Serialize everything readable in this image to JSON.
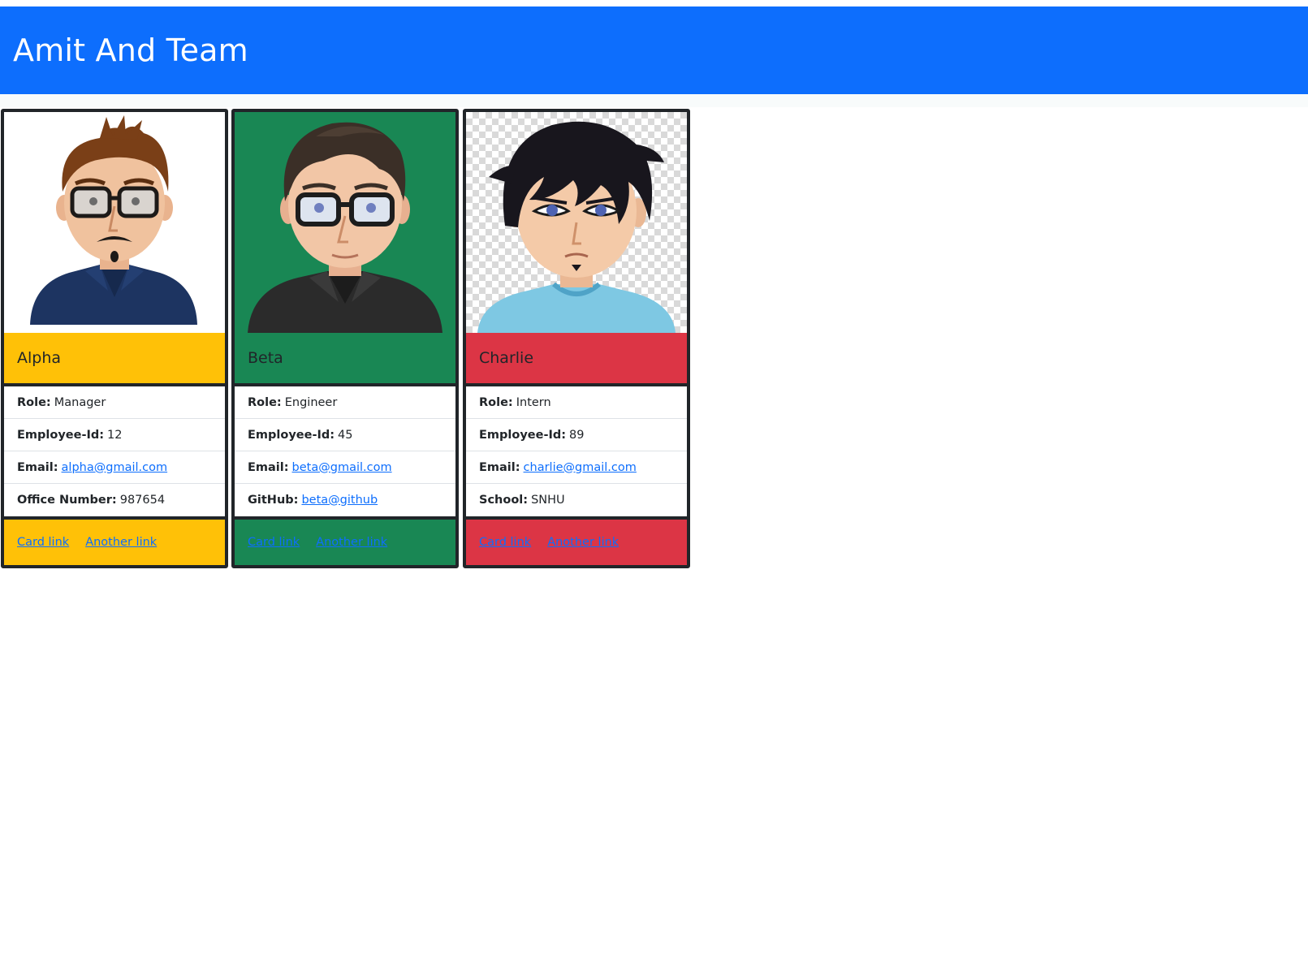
{
  "header": {
    "title": "Amit And Team"
  },
  "colors": {
    "header_bg": "#0d6efd",
    "alpha": "#ffc107",
    "beta": "#198754",
    "charlie": "#dc3545",
    "link": "#0d6efd"
  },
  "cards": [
    {
      "name": "Alpha",
      "avatar": "cartoon-man-glasses-mustache",
      "fields": [
        {
          "label": "Role:",
          "value": "Manager"
        },
        {
          "label": "Employee-Id:",
          "value": "12"
        },
        {
          "label": "Email:",
          "value": "alpha@gmail.com"
        },
        {
          "label": "Office Number:",
          "value": "987654"
        }
      ],
      "links": [
        "Card link",
        "Another link"
      ]
    },
    {
      "name": "Beta",
      "avatar": "cartoon-man-glasses",
      "fields": [
        {
          "label": "Role:",
          "value": "Engineer"
        },
        {
          "label": "Employee-Id:",
          "value": "45"
        },
        {
          "label": "Email:",
          "value": "beta@gmail.com"
        },
        {
          "label": "GitHub:",
          "value": "beta@github"
        }
      ],
      "links": [
        "Card link",
        "Another link"
      ]
    },
    {
      "name": "Charlie",
      "avatar": "cartoon-boy-black-hair",
      "fields": [
        {
          "label": "Role:",
          "value": "Intern"
        },
        {
          "label": "Employee-Id:",
          "value": "89"
        },
        {
          "label": "Email:",
          "value": "charlie@gmail.com"
        },
        {
          "label": "School:",
          "value": "SNHU"
        }
      ],
      "links": [
        "Card link",
        "Another link"
      ]
    }
  ]
}
